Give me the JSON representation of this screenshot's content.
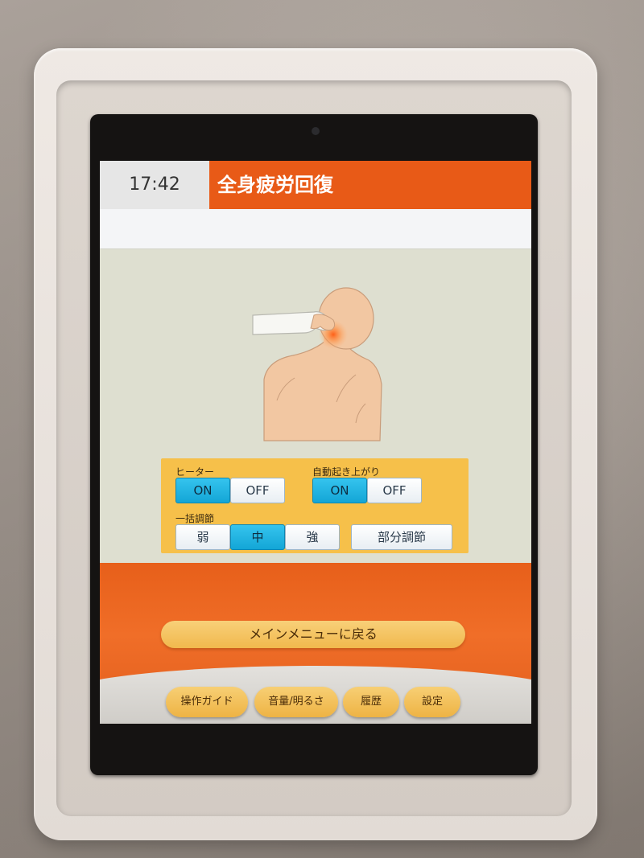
{
  "status": {
    "time": "17:42"
  },
  "header": {
    "title": "全身疲労回復"
  },
  "controls": {
    "heater": {
      "label": "ヒーター",
      "on": "ON",
      "off": "OFF",
      "selected": "ON"
    },
    "auto_rise": {
      "label": "自動起き上がり",
      "on": "ON",
      "off": "OFF",
      "selected": "ON"
    },
    "bulk_adjust": {
      "label": "一括調節",
      "weak": "弱",
      "medium": "中",
      "strong": "強",
      "selected": "中"
    },
    "partial_adjust": "部分調節"
  },
  "main_menu_button": "メインメニューに戻る",
  "footer": {
    "guide": "操作ガイド",
    "volume": "音量/明るさ",
    "history": "履歴",
    "settings": "設定"
  },
  "colors": {
    "accent": "#e85a17",
    "panel": "#f6c04a",
    "active_button": "#1fb4e3",
    "footer_button": "#f2bf58"
  }
}
